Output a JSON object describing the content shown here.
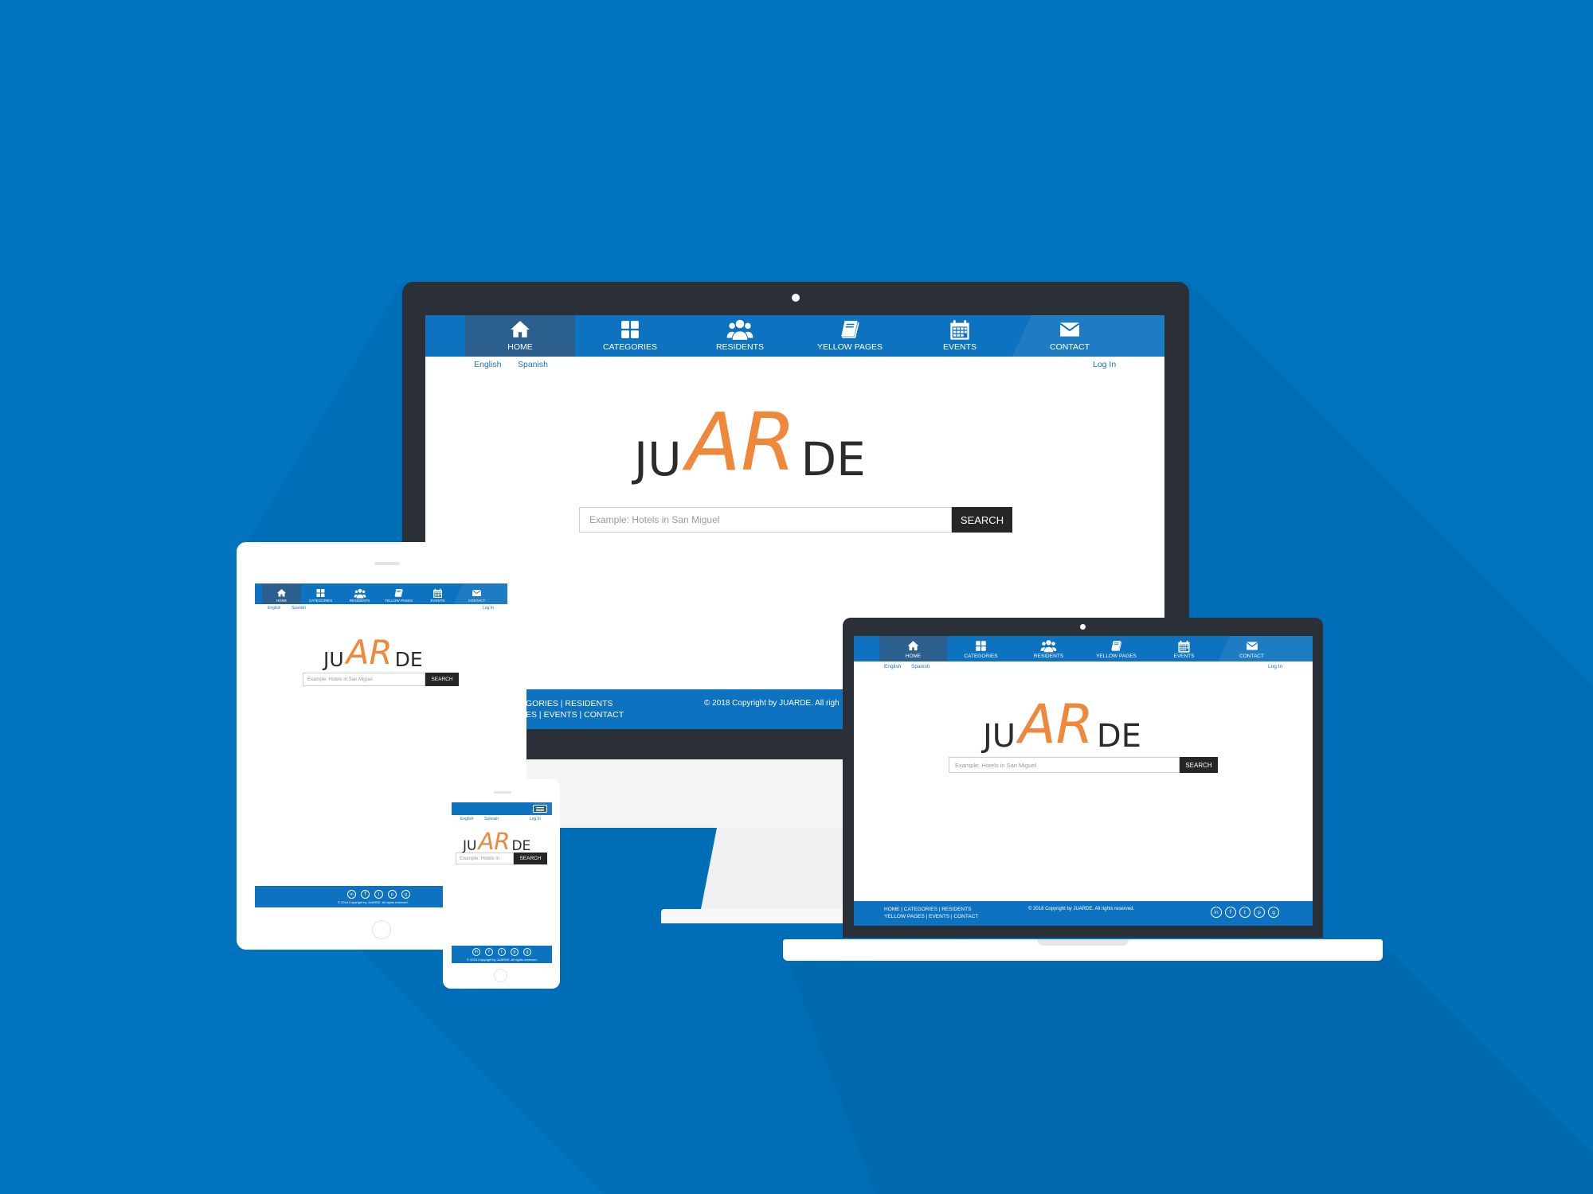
{
  "nav": {
    "items": [
      {
        "label": "HOME",
        "icon": "home-icon"
      },
      {
        "label": "CATEGORIES",
        "icon": "grid-icon"
      },
      {
        "label": "RESIDENTS",
        "icon": "users-icon"
      },
      {
        "label": "YELLOW PAGES",
        "icon": "book-icon"
      },
      {
        "label": "EVENTS",
        "icon": "calendar-icon"
      },
      {
        "label": "CONTACT",
        "icon": "envelope-icon"
      }
    ]
  },
  "lang": {
    "english": "English",
    "spanish": "Spanish",
    "login": "Log In"
  },
  "logo": {
    "part1": "JU",
    "part2": "AR",
    "part3": "DE"
  },
  "search": {
    "placeholder": "Example: Hotels in San Miguel",
    "mobile_placeholder": "Example: Hotels in",
    "button": "SEARCH"
  },
  "footer": {
    "links_line1": "HOME | CATEGORIES | RESIDENTS",
    "links_line2": "YELLOW PAGES | EVENTS | CONTACT",
    "desktop_links_line1": "GORIES | RESIDENTS",
    "desktop_links_line2": "ES | EVENTS | CONTACT",
    "copyright": "© 2018 Copyright by JUARDE. All rights reserved.",
    "desktop_copyright": "© 2018 Copyright by JUARDE. All righ",
    "social": [
      "linkedin-icon",
      "facebook-icon",
      "twitter-icon",
      "pinterest-icon",
      "google-plus-icon"
    ]
  },
  "colors": {
    "background": "#0173bf",
    "nav": "#0d72c0",
    "active_nav": "#2b5f8e",
    "accent": "#f0883c",
    "button": "#262626"
  }
}
